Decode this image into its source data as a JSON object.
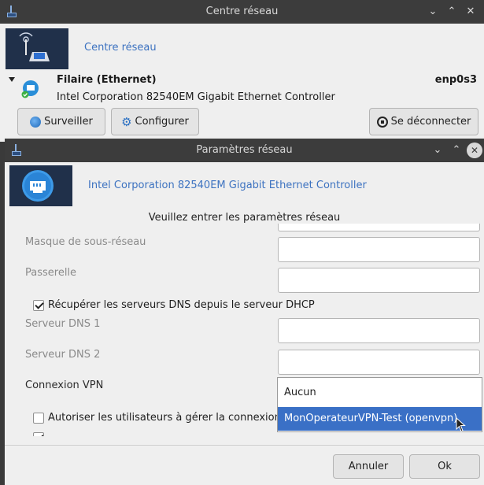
{
  "bg_window": {
    "title": "Centre réseau",
    "banner_link": "Centre réseau",
    "device": {
      "name": "Filaire (Ethernet)",
      "interface": "enp0s3",
      "description": "Intel Corporation 82540EM Gigabit Ethernet Controller"
    },
    "buttons": {
      "monitor": "Surveiller",
      "configure": "Configurer",
      "disconnect": "Se déconnecter"
    }
  },
  "dialog": {
    "title": "Paramètres réseau",
    "banner_link": "Intel Corporation 82540EM Gigabit Ethernet Controller",
    "subtitle": "Veuillez entrer les paramètres réseau",
    "fields": {
      "netmask_label": "Masque de sous-réseau",
      "gateway_label": "Passerelle",
      "dns_checkbox_label": "Récupérer les serveurs DNS depuis le serveur DHCP",
      "dns1_label": "Serveur DNS 1",
      "dns2_label": "Serveur DNS 2",
      "vpn_label": "Connexion VPN",
      "users_checkbox_label": "Autoriser les utilisateurs à gérer la connexion"
    },
    "checkbox_states": {
      "dns_checked": true,
      "users_checked": false
    },
    "vpn_options": [
      "Aucun",
      "MonOperateurVPN-Test (openvpn)"
    ],
    "vpn_highlighted": "MonOperateurVPN-Test (openvpn)",
    "buttons": {
      "cancel": "Annuler",
      "ok": "Ok"
    }
  },
  "colors": {
    "titlebar": "#3c3c3c",
    "accent": "#3c72c0",
    "highlight": "#3a70c6",
    "window": "#efefef"
  }
}
